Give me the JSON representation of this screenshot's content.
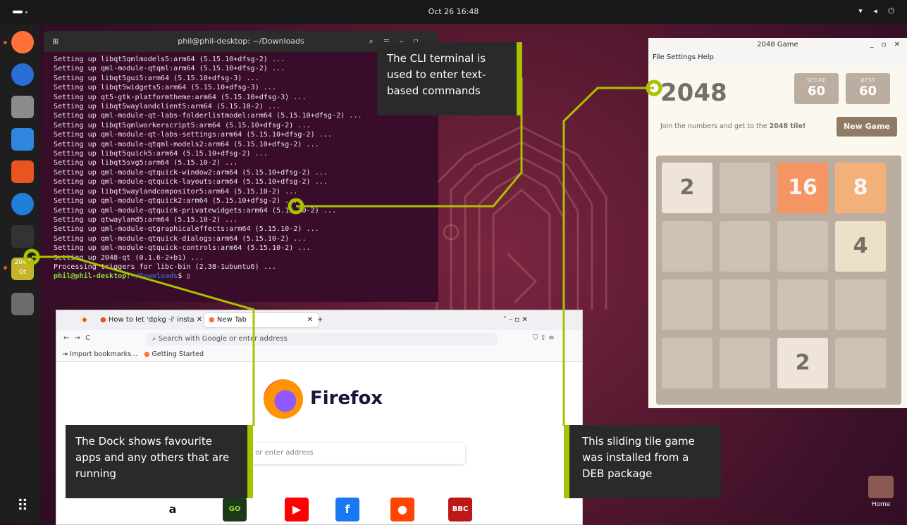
{
  "topbar": {
    "clock": "Oct 26  16:48",
    "tray": "▾ ◂ ⏻"
  },
  "dock": {
    "apps": [
      {
        "icon": "firefox-icon",
        "color": "#ff7139"
      },
      {
        "icon": "thunderbird-icon",
        "color": "#2a6fd6"
      },
      {
        "icon": "files-icon",
        "color": "#8c8c8c"
      },
      {
        "icon": "writer-icon",
        "color": "#2e86de"
      },
      {
        "icon": "software-icon",
        "color": "#e95420"
      },
      {
        "icon": "help-icon",
        "color": "#1f7fd8"
      },
      {
        "icon": "terminal-icon",
        "color": "#333333"
      },
      {
        "icon": "2048-qt-icon",
        "color": "#c5b32a"
      },
      {
        "icon": "trash-icon",
        "color": "#6c6c6c"
      }
    ],
    "qt_label_top": "2048",
    "qt_label_bottom": "Qt",
    "show_apps_glyph": "⠿"
  },
  "terminal": {
    "title": "phil@phil-desktop: ~/Downloads",
    "lines": [
      "Setting up libqt5qmlmodels5:arm64 (5.15.10+dfsg-2) ...",
      "Setting up qml-module-qtqml:arm64 (5.15.10+dfsg-2) ...",
      "Setting up libqt5gui5:arm64 (5.15.10+dfsg-3) ...",
      "Setting up libqt5widgets5:arm64 (5.15.10+dfsg-3) ...",
      "Setting up qt5-gtk-platformtheme:arm64 (5.15.10+dfsg-3) ...",
      "Setting up libqt5waylandclient5:arm64 (5.15.10-2) ...",
      "Setting up qml-module-qt-labs-folderlistmodel:arm64 (5.15.10+dfsg-2) ...",
      "Setting up libqt5qmlworkerscript5:arm64 (5.15.10+dfsg-2) ...",
      "Setting up qml-module-qt-labs-settings:arm64 (5.15.10+dfsg-2) ...",
      "Setting up qml-module-qtqml-models2:arm64 (5.15.10+dfsg-2) ...",
      "Setting up libqt5quick5:arm64 (5.15.10+dfsg-2) ...",
      "Setting up libqt5svg5:arm64 (5.15.10-2) ...",
      "Setting up qml-module-qtquick-window2:arm64 (5.15.10+dfsg-2) ...",
      "Setting up qml-module-qtquick-layouts:arm64 (5.15.10+dfsg-2) ...",
      "Setting up libqt5waylandcompositor5:arm64 (5.15.10-2) ...",
      "Setting up qml-module-qtquick2:arm64 (5.15.10+dfsg-2) ...",
      "Setting up qml-module-qtquick-privatewidgets:arm64 (5.15.10-2) ...",
      "Setting up qtwayland5:arm64 (5.15.10-2) ...",
      "Setting up qml-module-qtgraphicaleffects:arm64 (5.15.10-2) ...",
      "Setting up qml-module-qtquick-dialogs:arm64 (5.15.10-2) ...",
      "Setting up qml-module-qtquick-controls:arm64 (5.15.10-2) ...",
      "Setting up 2048-qt (0.1.6-2+b1) ...",
      "Processing triggers for libc-bin (2.38-1ubuntu6) ..."
    ],
    "prompt_user": "phil@phil-desktop:",
    "prompt_path": "~/Downloads",
    "prompt_end": "$ ▯"
  },
  "game": {
    "window_title": "2048 Game",
    "controls": "_ ▫ ✕",
    "menu": "File  Settings  Help",
    "title": "2048",
    "score_label": "SCORE",
    "score_value": "60",
    "best_label": "BEST",
    "best_value": "60",
    "tagline_pre": "Join the numbers and get to the ",
    "tagline_bold": "2048 tile!",
    "new_game": "New Game",
    "tiles": [
      {
        "value": "2",
        "row": 0,
        "col": 0
      },
      {
        "value": "16",
        "row": 0,
        "col": 2
      },
      {
        "value": "8",
        "row": 0,
        "col": 3
      },
      {
        "value": "4",
        "row": 1,
        "col": 3
      },
      {
        "value": "2",
        "row": 3,
        "col": 2
      }
    ]
  },
  "firefox": {
    "tab1": "How to let 'dpkg -i' insta ✕",
    "tab2": "New Tab",
    "tab2_close": "✕",
    "new_tab": "+",
    "window_controls": "˅    –   ▫   ✕",
    "nav": "←  →  C",
    "url_placeholder": "Search with Google or enter address",
    "toolbar_right": "⛉   ⇧   ≡",
    "bookmark1": "⇥ Import bookmarks...",
    "bookmark2": "Getting Started",
    "brand": "Firefox",
    "search_placeholder": "le or enter address",
    "shortcuts": [
      {
        "label": "a",
        "color": "#ffffff",
        "fg": "#111"
      },
      {
        "label": "GO",
        "color": "#1a3a1a",
        "fg": "#9bd23c"
      },
      {
        "label": "▶",
        "color": "#ff0000",
        "fg": "#fff"
      },
      {
        "label": "f",
        "color": "#1877f2",
        "fg": "#fff"
      },
      {
        "label": "●",
        "color": "#ff4500",
        "fg": "#fff"
      },
      {
        "label": "BBC",
        "color": "#bb1919",
        "fg": "#fff"
      }
    ]
  },
  "callouts": {
    "cli": "The CLI terminal is used to enter text-based commands",
    "dock": "The Dock shows favourite apps and any others that are running",
    "game": "This sliding tile game was installed from a DEB package"
  },
  "desktop": {
    "home_label": "Home"
  },
  "colors": {
    "accent": "#a8c200",
    "ubuntu_orange": "#e95420"
  }
}
